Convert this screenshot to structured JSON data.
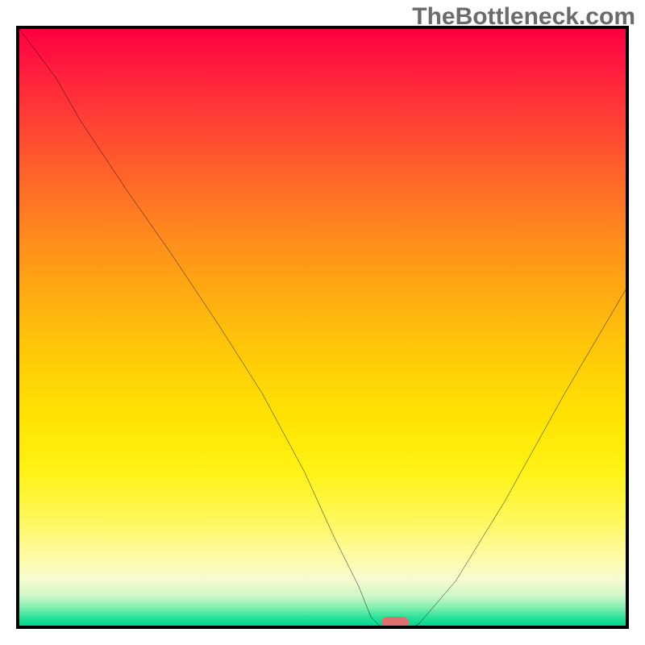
{
  "watermark": "TheBottleneck.com",
  "chart_data": {
    "type": "line",
    "title": "",
    "xlabel": "",
    "ylabel": "",
    "xlim": [
      0,
      100
    ],
    "ylim": [
      0,
      100
    ],
    "grid": false,
    "series": [
      {
        "name": "curve",
        "x": [
          0,
          6,
          10,
          18,
          25,
          33,
          40,
          47,
          52,
          56,
          58,
          60,
          62,
          64,
          66,
          72,
          80,
          90,
          100
        ],
        "values": [
          100,
          92,
          85,
          73,
          63,
          51,
          40,
          27,
          16,
          8,
          3,
          1,
          0.5,
          0.6,
          2,
          9,
          22,
          40,
          57
        ]
      }
    ],
    "marker": {
      "x": 62,
      "y": 0.5,
      "color": "#e07070"
    },
    "gradient_colors_top_to_bottom": [
      "#ff0040",
      "#ff4a32",
      "#ffa314",
      "#ffe504",
      "#fffba0",
      "#00d890"
    ]
  }
}
